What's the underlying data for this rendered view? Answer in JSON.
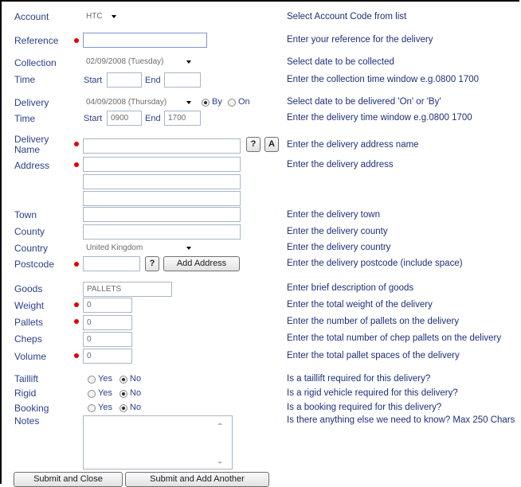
{
  "account": {
    "label": "Account",
    "value": "HTC",
    "help": "Select Account Code from list"
  },
  "reference": {
    "label": "Reference",
    "value": "",
    "help": "Enter your reference for the delivery"
  },
  "collection": {
    "label": "Collection",
    "date": "02/09/2008 (Tuesday)",
    "help": "Select date to be collected"
  },
  "collection_time": {
    "label": "Time",
    "start_label": "Start",
    "start": "",
    "end_label": "End",
    "end": "",
    "help": "Enter the collection time window e.g.0800 1700"
  },
  "delivery": {
    "label": "Delivery",
    "date": "04/09/2008 (Thursday)",
    "by_label": "By",
    "on_label": "On",
    "help": "Select date to be delivered 'On' or 'By'"
  },
  "delivery_time": {
    "label": "Time",
    "start_label": "Start",
    "start": "0900",
    "end_label": "End",
    "end": "1700",
    "help": "Enter the delivery time window e.g.0800 1700"
  },
  "delivery_name": {
    "label_line1": "Delivery",
    "label_line2": "Name",
    "value": "",
    "help_button": "?",
    "address_button": "A",
    "help": "Enter the delivery address name"
  },
  "address": {
    "label": "Address",
    "line1": "",
    "line2": "",
    "line3": "",
    "help": "Enter the delivery address"
  },
  "town": {
    "label": "Town",
    "value": "",
    "help": "Enter the delivery town"
  },
  "county": {
    "label": "County",
    "value": "",
    "help": "Enter the delivery county"
  },
  "country": {
    "label": "Country",
    "value": "United Kingdom",
    "help": "Enter the delivery country"
  },
  "postcode": {
    "label": "Postcode",
    "value": "",
    "help_button": "?",
    "add_address_button": "Add Address",
    "help": "Enter the delivery postcode (include space)"
  },
  "goods": {
    "label": "Goods",
    "value": "PALLETS",
    "help": "Enter brief description of goods"
  },
  "weight": {
    "label": "Weight",
    "value": "0",
    "help": "Enter the total weight of the delivery"
  },
  "pallets": {
    "label": "Pallets",
    "value": "0",
    "help": "Enter the number of pallets on the delivery"
  },
  "cheps": {
    "label": "Cheps",
    "value": "0",
    "help": "Enter the total number of chep pallets on the delivery"
  },
  "volume": {
    "label": "Volume",
    "value": "0",
    "help": "Enter the total pallet spaces of the delivery"
  },
  "taillift": {
    "label": "Taillift",
    "yes": "Yes",
    "no": "No",
    "selected": "No",
    "help": "Is a taillift required for this delivery?"
  },
  "rigid": {
    "label": "Rigid",
    "yes": "Yes",
    "no": "No",
    "selected": "No",
    "help": "Is a rigid vehicle required for this delivery?"
  },
  "booking": {
    "label": "Booking",
    "yes": "Yes",
    "no": "No",
    "selected": "No",
    "help": "Is a booking required for this delivery?"
  },
  "notes": {
    "label": "Notes",
    "value": "",
    "help": "Is there anything else we need to know? Max 250 Chars"
  },
  "buttons": {
    "submit_close": "Submit and Close",
    "submit_add": "Submit and Add Another"
  },
  "colors": {
    "label": "#2b3f8c",
    "help": "#1e2f7a",
    "required_marker": "#e00000"
  }
}
